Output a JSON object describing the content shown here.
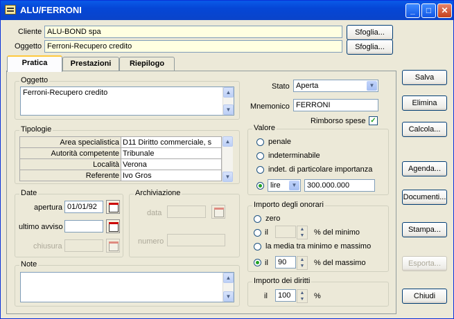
{
  "window": {
    "title": "ALU/FERRONI"
  },
  "header": {
    "cliente_label": "Cliente",
    "cliente_value": "ALU-BOND spa",
    "oggetto_label": "Oggetto",
    "oggetto_value": "Ferroni-Recupero credito",
    "browse1": "Sfoglia...",
    "browse2": "Sfoglia..."
  },
  "tabs": [
    "Pratica",
    "Prestazioni",
    "Riepilogo"
  ],
  "oggetto_group": {
    "title": "Oggetto",
    "text": "Ferroni-Recupero credito"
  },
  "stato": {
    "label": "Stato",
    "value": "Aperta"
  },
  "mnemonico": {
    "label": "Mnemonico",
    "value": "FERRONI"
  },
  "rimborso": {
    "label": "Rimborso spese",
    "checked": true
  },
  "tipologie": {
    "title": "Tipologie",
    "rows": [
      {
        "k": "Area specialistica",
        "v": "D11 Diritto commerciale, s"
      },
      {
        "k": "Autorità competente",
        "v": "Tribunale"
      },
      {
        "k": "Località",
        "v": "Verona"
      },
      {
        "k": "Referente",
        "v": "Ivo Gros"
      }
    ]
  },
  "valore": {
    "title": "Valore",
    "opt1": "penale",
    "opt2": "indeterminabile",
    "opt3": "indet. di particolare importanza",
    "currency": "lire",
    "amount": "300.000.000"
  },
  "date": {
    "title": "Date",
    "apertura_label": "apertura",
    "apertura": "01/01/92",
    "avviso_label": "ultimo avviso",
    "chiusura_label": "chiusura"
  },
  "archiviazione": {
    "title": "Archiviazione",
    "data_label": "data",
    "numero_label": "numero"
  },
  "onorari": {
    "title": "Importo degli onorari",
    "zero": "zero",
    "il1": "il",
    "minimo": "% del minimo",
    "media": "la media tra minimo e massimo",
    "il2": "il",
    "value2": "90",
    "massimo": "% del massimo"
  },
  "diritti": {
    "title": "Importo dei diritti",
    "il": "il",
    "value": "100",
    "pct": "%"
  },
  "note": {
    "title": "Note"
  },
  "buttons": {
    "salva": "Salva",
    "elimina": "Elimina",
    "calcola": "Calcola...",
    "agenda": "Agenda...",
    "documenti": "Documenti...",
    "stampa": "Stampa...",
    "esporta": "Esporta...",
    "chiudi": "Chiudi"
  }
}
